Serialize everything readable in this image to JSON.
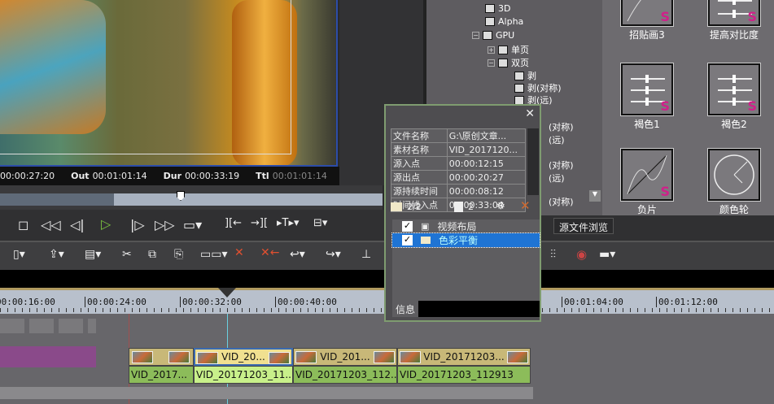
{
  "timecode": {
    "in_value": "00:00:27:20",
    "out_label": "Out",
    "out_value": "00:01:01:14",
    "dur_label": "Dur",
    "dur_value": "00:00:33:19",
    "ttl_label": "Ttl",
    "ttl_value": "00:01:01:14"
  },
  "tree": [
    "3D",
    "Alpha",
    "GPU",
    "单页",
    "双页",
    "剥",
    "剥(对称)",
    "剥(远)",
    "(对称)",
    "(远)",
    "(对称)",
    "(远)",
    "(对称)"
  ],
  "effects": [
    {
      "label": "招贴画3"
    },
    {
      "label": "提高对比度"
    },
    {
      "label": "褐色1"
    },
    {
      "label": "褐色2"
    },
    {
      "label": "负片"
    },
    {
      "label": "颜色轮"
    }
  ],
  "tab_source_browser": "源文件浏览",
  "dialog": {
    "close": "✕",
    "rows": [
      [
        "文件名称",
        "G:\\原创文章..."
      ],
      [
        "素材名称",
        "VID_2017120..."
      ],
      [
        "源入点",
        "00:00:12:15"
      ],
      [
        "源出点",
        "00:00:20:27"
      ],
      [
        "源持续时间",
        "00:00:08:12"
      ],
      [
        "时间线入点",
        "00:00:33:04"
      ]
    ],
    "count_filters": "2/2",
    "count_layers": "2",
    "filters": [
      {
        "label": "视频布局",
        "checked": true
      },
      {
        "label": "色彩平衡",
        "checked": true,
        "selected": true
      }
    ],
    "tab_info": "信息"
  },
  "ruler": [
    "00:00:16:00",
    "00:00:24:00",
    "00:00:32:00",
    "00:00:40:00",
    "00:01:04:00",
    "00:01:12:00"
  ],
  "video_clips": [
    "VID_20...",
    "VID_201...",
    "VID_20171203..."
  ],
  "audio_clips": [
    "VID_2017...",
    "VID_20171203_11...",
    "VID_20171203_112...",
    "VID_20171203_112913"
  ]
}
